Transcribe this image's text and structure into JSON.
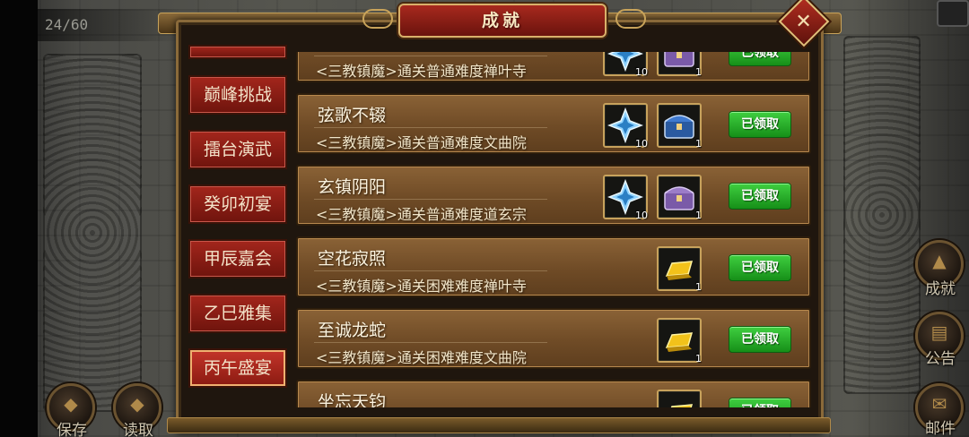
{
  "hud": {
    "counter": "24/60",
    "left_buttons": [
      {
        "label": "保存"
      },
      {
        "label": "读取"
      }
    ],
    "right_buttons": [
      {
        "label": "成就"
      },
      {
        "label": "公告"
      },
      {
        "label": "邮件"
      }
    ]
  },
  "dialog": {
    "title": "成就",
    "close_glyph": "✕",
    "tabs": [
      {
        "label": "巅峰挑战",
        "active": false
      },
      {
        "label": "擂台演武",
        "active": false
      },
      {
        "label": "癸卯初宴",
        "active": false
      },
      {
        "label": "甲辰嘉会",
        "active": false
      },
      {
        "label": "乙巳雅集",
        "active": false
      },
      {
        "label": "丙午盛宴",
        "active": true
      }
    ],
    "achievements": [
      {
        "name": "",
        "desc": "<三教镇魔>通关普通难度禅叶寺",
        "rewards": [
          {
            "icon": "crystal-icon",
            "qty": "10"
          },
          {
            "icon": "chest-purple-icon",
            "qty": "1"
          }
        ],
        "status": "已领取"
      },
      {
        "name": "弦歌不辍",
        "desc": "<三教镇魔>通关普通难度文曲院",
        "rewards": [
          {
            "icon": "crystal-icon",
            "qty": "10"
          },
          {
            "icon": "chest-blue-icon",
            "qty": "1"
          }
        ],
        "status": "已领取"
      },
      {
        "name": "玄镇阴阳",
        "desc": "<三教镇魔>通关普通难度道玄宗",
        "rewards": [
          {
            "icon": "crystal-icon",
            "qty": "10"
          },
          {
            "icon": "chest-purple-icon",
            "qty": "1"
          }
        ],
        "status": "已领取"
      },
      {
        "name": "空花寂照",
        "desc": "<三教镇魔>通关困难难度禅叶寺",
        "rewards": [
          {
            "icon": "gold-bar-icon",
            "qty": "1"
          }
        ],
        "status": "已领取"
      },
      {
        "name": "至诚龙蛇",
        "desc": "<三教镇魔>通关困难难度文曲院",
        "rewards": [
          {
            "icon": "gold-bar-icon",
            "qty": "1"
          }
        ],
        "status": "已领取"
      },
      {
        "name": "坐忘天钧",
        "desc": "",
        "rewards": [
          {
            "icon": "gold-bar-icon",
            "qty": ""
          }
        ],
        "status": "已领取"
      }
    ]
  }
}
